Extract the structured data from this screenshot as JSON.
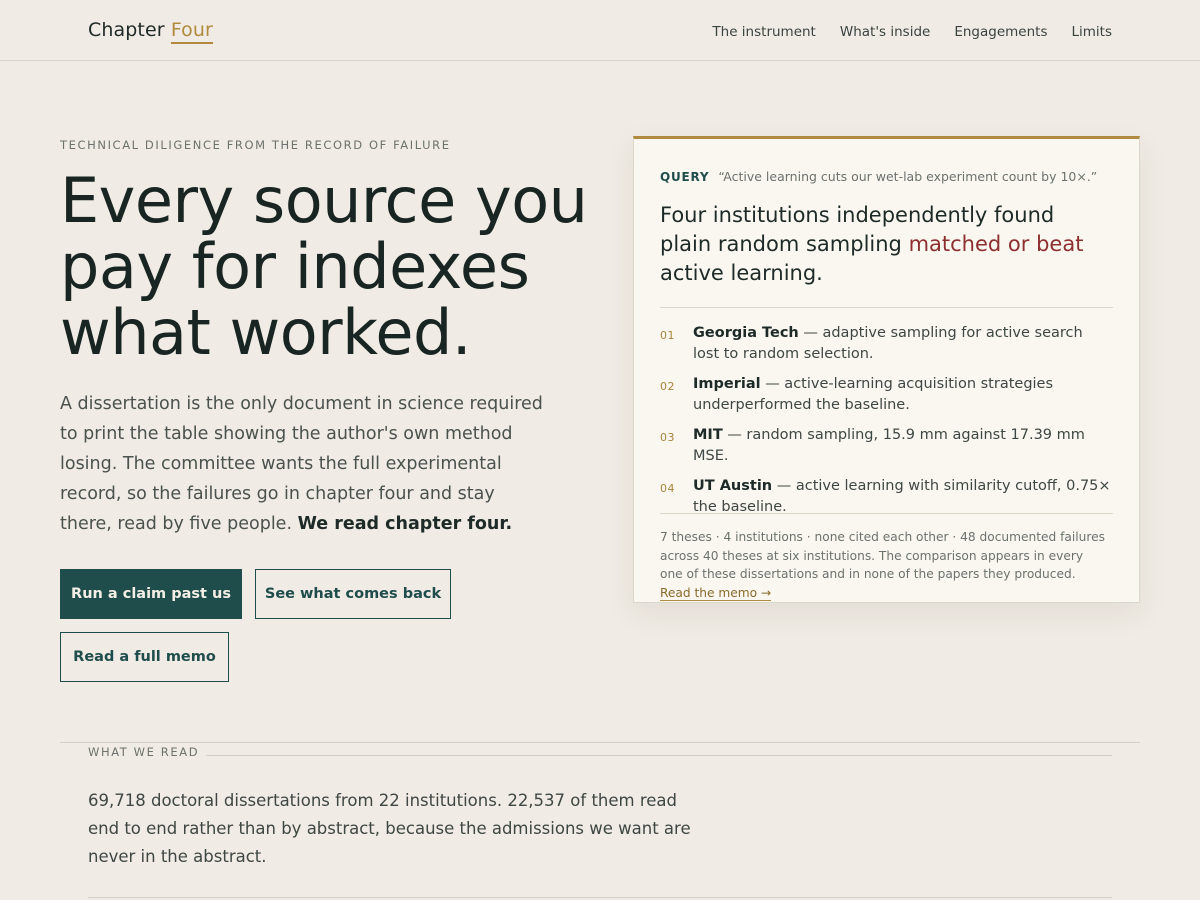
{
  "header": {
    "brand_main": "Chapter",
    "brand_accent": "Four",
    "nav": [
      "The instrument",
      "What's inside",
      "Engagements",
      "Limits"
    ]
  },
  "hero": {
    "eyebrow": "TECHNICAL DILIGENCE FROM THE RECORD OF FAILURE",
    "headline": "Every source you pay for indexes what worked.",
    "lede": "A dissertation is the only document in science required to print the table showing the author's own method losing. The committee wants the full experimental record, so the failures go in chapter four and stay there, read by five people.",
    "lede_bold": "We read chapter four.",
    "buttons": {
      "primary": "Run a claim past us",
      "secondary": "See what comes back",
      "tertiary": "Read a full memo"
    }
  },
  "card": {
    "query_label": "QUERY",
    "query_text": "“Active learning cuts our wet-lab experiment count by 10×.”",
    "finding_pre": "Four institutions independently found plain random sampling",
    "finding_highlight": "matched or beat",
    "finding_post": "active learning.",
    "items": [
      {
        "num": "01",
        "institution": "Georgia Tech",
        "text": "— adaptive sampling for active search lost to random selection."
      },
      {
        "num": "02",
        "institution": "Imperial",
        "text": "— active-learning acquisition strategies underperformed the baseline."
      },
      {
        "num": "03",
        "institution": "MIT",
        "text": "— random sampling, 15.9 mm against 17.39 mm MSE."
      },
      {
        "num": "04",
        "institution": "UT Austin",
        "text": "— active learning with similarity cutoff, 0.75× the baseline."
      }
    ],
    "footnote": "7 theses · 4 institutions · none cited each other · 48 documented failures across 40 theses at six institutions. The comparison appears in every one of these dissertations and in none of the papers they produced.",
    "memo_link": "Read the memo →"
  },
  "what_we_read": {
    "label": "WHAT WE READ",
    "body": "69,718 doctoral dissertations from 22 institutions. 22,537 of them read end to end rather than by abstract, because the admissions we want are never in the abstract."
  },
  "colors": {
    "background": "#f0ebe4",
    "accent_gold": "#b08a3e",
    "primary_teal": "#1e4d4b",
    "highlight_red": "#8e2f2f",
    "card_bg": "#faf7f1"
  }
}
